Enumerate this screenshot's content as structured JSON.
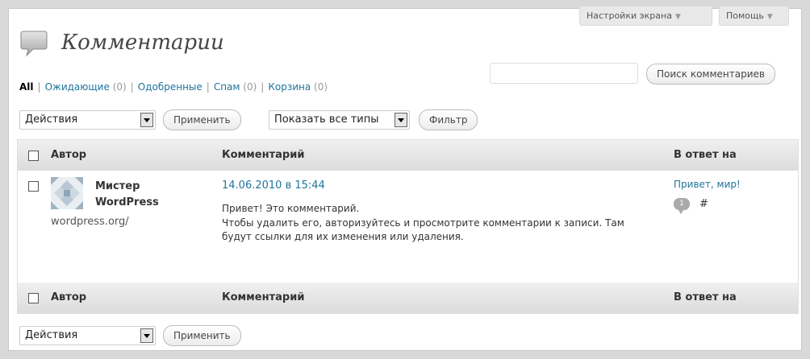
{
  "header": {
    "screen_options_label": "Настройки экрана",
    "help_label": "Помощь",
    "page_title": "Комментарии"
  },
  "filters": {
    "all_label": "All",
    "pending_label": "Ожидающие",
    "pending_count": "(0)",
    "approved_label": "Одобренные",
    "spam_label": "Спам",
    "spam_count": "(0)",
    "trash_label": "Корзина",
    "trash_count": "(0)",
    "separator": "|"
  },
  "search": {
    "input_value": "",
    "button_label": "Поиск комментариев"
  },
  "toolbar_top": {
    "bulk_action": "Действия",
    "apply_label": "Применить",
    "type_filter": "Показать все типы",
    "filter_label": "Фильтр"
  },
  "table": {
    "columns": {
      "author": "Автор",
      "comment": "Комментарий",
      "response": "В ответ на"
    },
    "rows": [
      {
        "author_name_line1": "Мистер",
        "author_name_line2": "WordPress",
        "author_url": "wordpress.org/",
        "date": "14.06.2010 в 15:44",
        "text_line1": "Привет! Это комментарий.",
        "text_line2": "Чтобы удалить его, авторизуйтесь и просмотрите комментарии к записи. Там будут ссылки для их изменения или удаления.",
        "response_title": "Привет, мир!",
        "comment_count": "1",
        "permalink": "#"
      }
    ]
  },
  "toolbar_bottom": {
    "bulk_action": "Действия",
    "apply_label": "Применить"
  },
  "colors": {
    "link": "#21759b",
    "header_bg": "#dcdcdc",
    "bubble": "#aaaaaa"
  },
  "icons": {
    "title": "comments-bubble-icon",
    "avatar": "identicon-avatar",
    "dropdown": "chevron-down-icon"
  }
}
